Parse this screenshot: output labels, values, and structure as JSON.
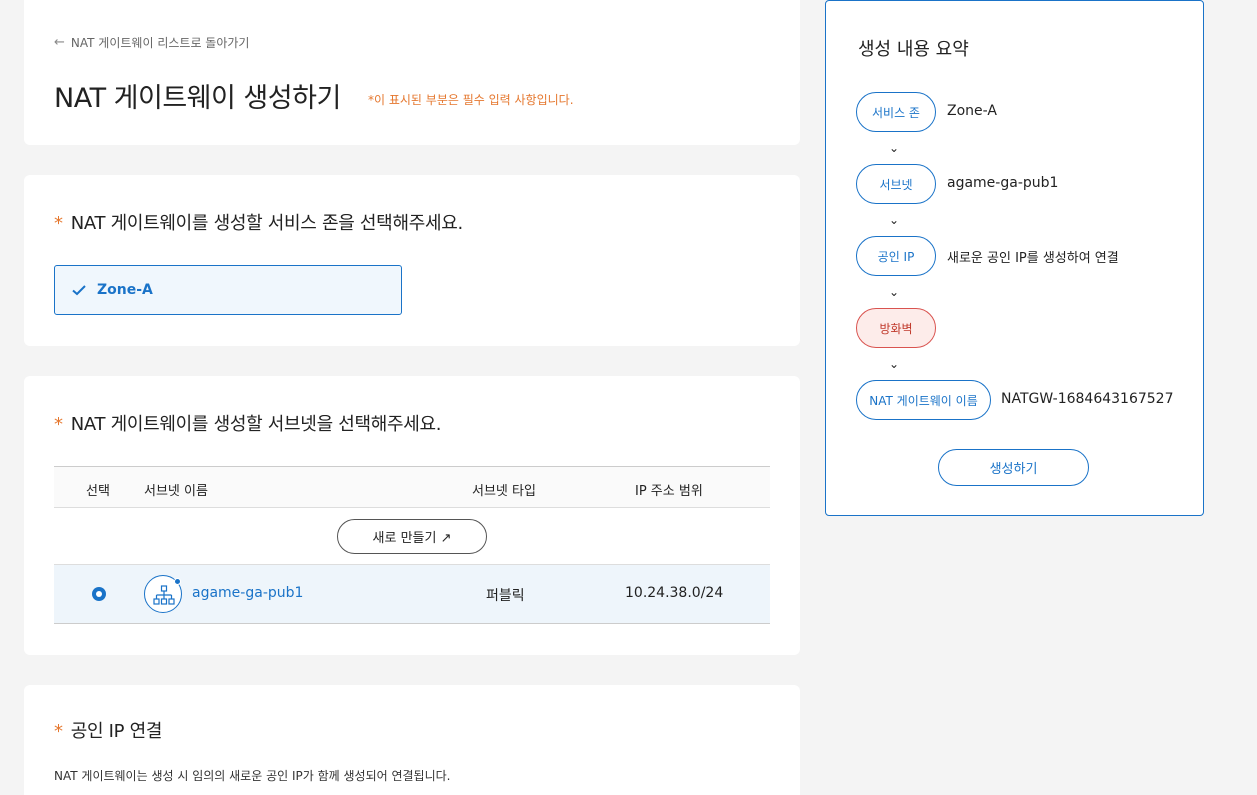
{
  "header": {
    "back_link": "NAT 게이트웨이 리스트로 돌아가기",
    "title": "NAT 게이트웨이 생성하기",
    "required_note": "*이 표시된 부분은 필수 입력 사항입니다."
  },
  "zone_section": {
    "star": "*",
    "title": "NAT 게이트웨이를 생성할 서비스 존을 선택해주세요.",
    "selected_zone": "Zone-A"
  },
  "subnet_section": {
    "star": "*",
    "title": "NAT 게이트웨이를 생성할 서브넷을 선택해주세요.",
    "columns": [
      "선택",
      "서브넷 이름",
      "서브넷 타입",
      "IP 주소 범위"
    ],
    "new_button": "새로 만들기 ↗",
    "rows": [
      {
        "name": "agame-ga-pub1",
        "type": "퍼블릭",
        "range": "10.24.38.0/24",
        "selected": true
      }
    ]
  },
  "public_ip_section": {
    "star": "*",
    "title": "공인 IP 연결",
    "description": "NAT 게이트웨이는 생성 시 임의의 새로운 공인 IP가 함께 생성되어 연결됩니다."
  },
  "summary": {
    "title": "생성 내용 요약",
    "steps": [
      {
        "label": "서비스 존",
        "value": "Zone-A"
      },
      {
        "label": "서브넷",
        "value": "agame-ga-pub1"
      },
      {
        "label": "공인 IP",
        "value": "새로운 공인 IP를 생성하여 연결"
      },
      {
        "label": "방화벽",
        "value": ""
      },
      {
        "label": "NAT 게이트웨이 이름",
        "value": "NATGW-1684643167527"
      }
    ],
    "create_button": "생성하기"
  },
  "colors": {
    "accent": "#1a73c8",
    "required": "#e5772e",
    "warning": "#c0392b"
  }
}
